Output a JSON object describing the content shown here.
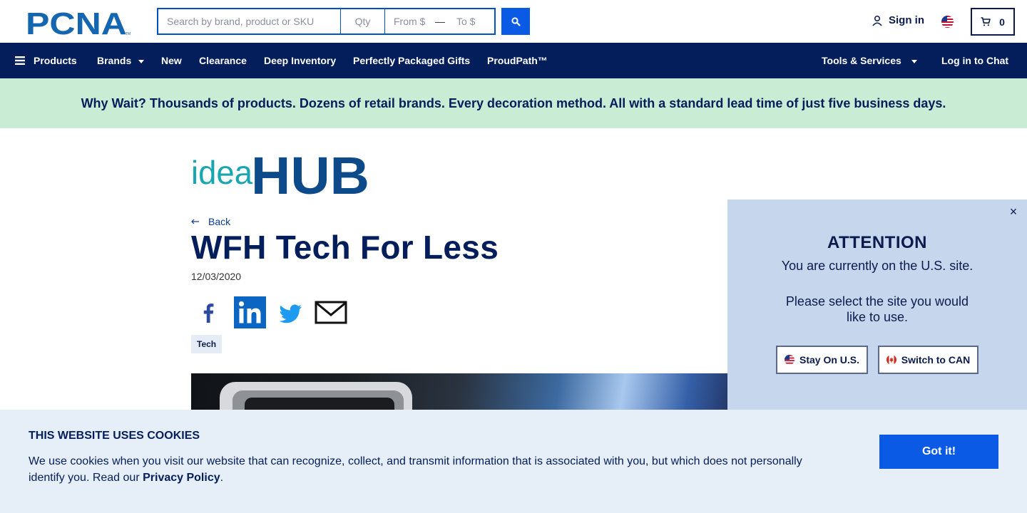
{
  "header": {
    "logo_text": "PCNA",
    "search": {
      "placeholder": "Search by brand, product or SKU",
      "qty_placeholder": "Qty",
      "from_placeholder": "From $",
      "to_placeholder": "To $"
    },
    "signin_label": "Sign in",
    "cart_count": "0",
    "icons": {
      "search": "search-icon",
      "user": "user-icon",
      "flag": "us-flag-icon",
      "cart": "cart-icon"
    }
  },
  "nav": {
    "items": [
      {
        "label": "Products"
      },
      {
        "label": "Brands"
      },
      {
        "label": "New"
      },
      {
        "label": "Clearance"
      },
      {
        "label": "Deep Inventory"
      },
      {
        "label": "Perfectly Packaged Gifts"
      },
      {
        "label": "ProudPath™"
      }
    ],
    "tools_label": "Tools & Services",
    "chat_label": "Log in to Chat"
  },
  "promo": {
    "text": "Why Wait? Thousands of products. Dozens of retail brands. Every decoration method. All with a standard lead time of just five business days."
  },
  "article": {
    "logo_light": "idea",
    "logo_bold": "HUB",
    "back_label": "Back",
    "title": "WFH Tech For Less",
    "date": "12/03/2020",
    "tag": "Tech",
    "share": [
      "facebook-icon",
      "linkedin-icon",
      "twitter-icon",
      "email-icon"
    ]
  },
  "attention": {
    "title": "ATTENTION",
    "line1": "You are currently on the U.S. site.",
    "line2": "Please select the site you would like to use.",
    "stay_label": "Stay On U.S.",
    "switch_label": "Switch to CAN",
    "close_glyph": "×"
  },
  "cookie": {
    "title": "THIS WEBSITE USES COOKIES",
    "text": "We use cookies when you visit our website that can recognize, collect, and transmit information that is associated with you, but which does not personally identify you. Read our ",
    "link_label": "Privacy Policy",
    "text_end": ".",
    "button_label": "Got it!"
  },
  "colors": {
    "navy": "#041e5b",
    "accent_blue": "#0a5ae6",
    "promo_bg": "#c8ecd4",
    "cookie_bg": "#e6eef8",
    "modal_bg": "#c6d6ec",
    "logo_blue": "#1566b0",
    "idea_teal": "#1aa6b0"
  }
}
